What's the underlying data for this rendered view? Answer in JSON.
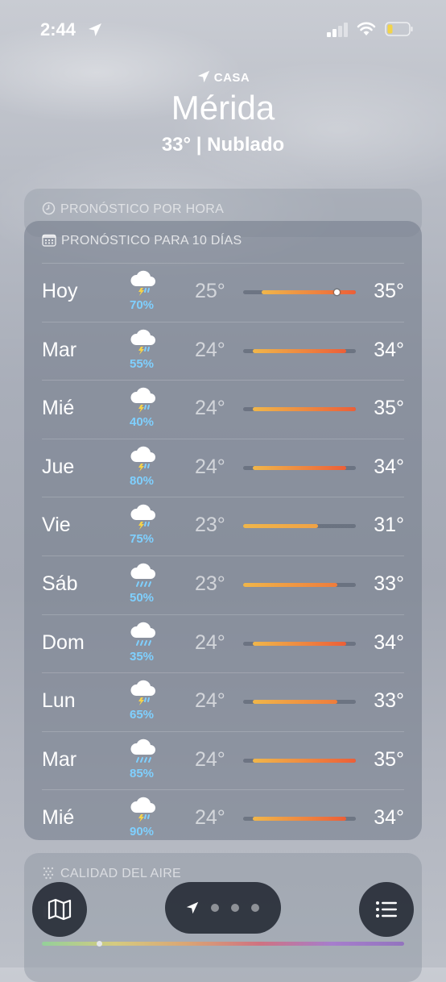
{
  "status_bar": {
    "time": "2:44",
    "battery_color": "#f2d44a"
  },
  "header": {
    "home_label": "CASA",
    "city": "Mérida",
    "condition": "33°  |  Nublado"
  },
  "hourly": {
    "title": "PRONÓSTICO POR HORA"
  },
  "ten_day": {
    "title": "PRONÓSTICO PARA 10 DÍAS",
    "range_min": 23,
    "range_max": 35,
    "days": [
      {
        "day": "Hoy",
        "icon": "thunderstorm-icon",
        "chance": "70%",
        "low": "25°",
        "high": "35°",
        "lo_v": 25,
        "hi_v": 35,
        "current_v": 33
      },
      {
        "day": "Mar",
        "icon": "thunderstorm-icon",
        "chance": "55%",
        "low": "24°",
        "high": "34°",
        "lo_v": 24,
        "hi_v": 34
      },
      {
        "day": "Mié",
        "icon": "thunderstorm-icon",
        "chance": "40%",
        "low": "24°",
        "high": "35°",
        "lo_v": 24,
        "hi_v": 35
      },
      {
        "day": "Jue",
        "icon": "thunderstorm-icon",
        "chance": "80%",
        "low": "24°",
        "high": "34°",
        "lo_v": 24,
        "hi_v": 34
      },
      {
        "day": "Vie",
        "icon": "thunderstorm-icon",
        "chance": "75%",
        "low": "23°",
        "high": "31°",
        "lo_v": 23,
        "hi_v": 31
      },
      {
        "day": "Sáb",
        "icon": "rain-icon",
        "chance": "50%",
        "low": "23°",
        "high": "33°",
        "lo_v": 23,
        "hi_v": 33
      },
      {
        "day": "Dom",
        "icon": "rain-icon",
        "chance": "35%",
        "low": "24°",
        "high": "34°",
        "lo_v": 24,
        "hi_v": 34
      },
      {
        "day": "Lun",
        "icon": "thunderstorm-icon",
        "chance": "65%",
        "low": "24°",
        "high": "33°",
        "lo_v": 24,
        "hi_v": 33
      },
      {
        "day": "Mar",
        "icon": "rain-icon",
        "chance": "85%",
        "low": "24°",
        "high": "35°",
        "lo_v": 24,
        "hi_v": 35
      },
      {
        "day": "Mié",
        "icon": "thunderstorm-icon",
        "chance": "90%",
        "low": "24°",
        "high": "34°",
        "lo_v": 24,
        "hi_v": 34
      }
    ]
  },
  "air_quality": {
    "title": "CALIDAD DEL AIRE",
    "value": "na"
  },
  "colors": {
    "precip": "#7fd0ff",
    "bar_cool": "#f0b64a",
    "bar_warm": "#ee6a3a"
  }
}
